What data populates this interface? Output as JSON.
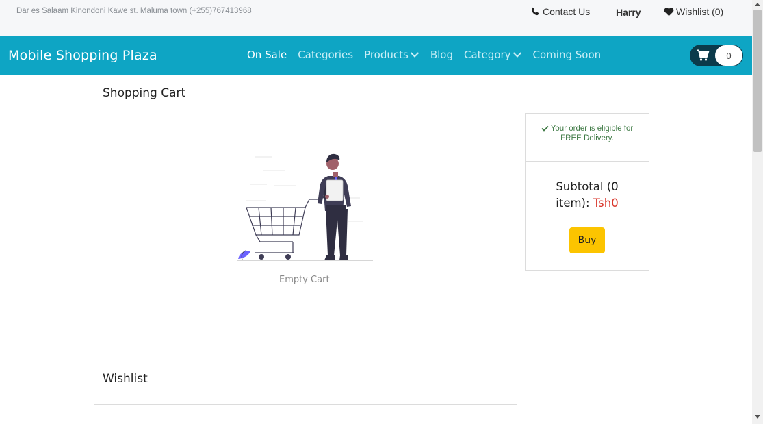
{
  "topbar": {
    "address": "Dar es Salaam Kinondoni Kawe st. Maluma town (+255)767413968",
    "contact_label": "Contact Us",
    "user_name": "Harry",
    "wishlist_label": "Wishlist (0)"
  },
  "navbar": {
    "brand": "Mobile Shopping Plaza",
    "items": [
      {
        "label": "On Sale"
      },
      {
        "label": "Categories"
      },
      {
        "label": "Products"
      },
      {
        "label": "Blog"
      },
      {
        "label": "Category"
      },
      {
        "label": "Coming Soon"
      }
    ],
    "cart_count": "0"
  },
  "cart": {
    "title": "Shopping Cart",
    "empty_label": "Empty Cart"
  },
  "summary": {
    "eligible_line1": "Your order is eligible for",
    "eligible_line2": "FREE Delivery.",
    "subtotal_line1": "Subtotal (0",
    "subtotal_line2": "item):",
    "subtotal_value": "Tsh0",
    "buy_label": "Buy"
  },
  "wishlist": {
    "title": "Wishlist"
  },
  "colors": {
    "navbar": "#0ea5c4",
    "buy_button": "#fcc400",
    "price": "#d9362b",
    "eligible": "#3f7a45"
  }
}
